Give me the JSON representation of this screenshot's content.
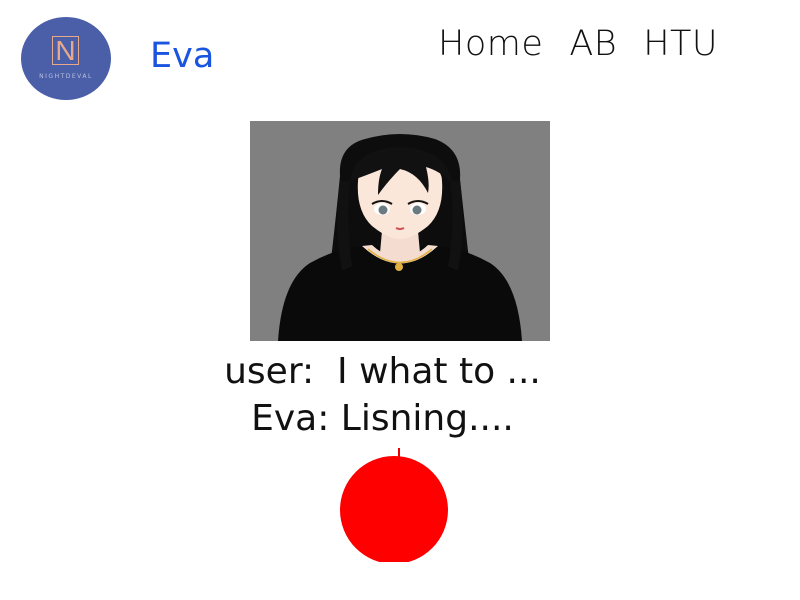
{
  "header": {
    "logo": {
      "letter": "N",
      "subtext": "NIGHTDEVAL",
      "icon": "nightdeval-logo-icon"
    },
    "brand_name": "Eva",
    "nav": [
      {
        "label": "Home"
      },
      {
        "label": "AB"
      },
      {
        "label": "HTU"
      }
    ]
  },
  "avatar": {
    "icon": "anime-avatar-image"
  },
  "transcript": {
    "user_line": "user:  I what to ...",
    "eva_line": "Eva: Lisning...."
  },
  "mic": {
    "icon": "record-button",
    "state": "listening"
  },
  "colors": {
    "brand": "#1a55e0",
    "logo_bg": "#4a5fa8",
    "logo_accent": "#e8a98a",
    "avatar_bg": "#808080",
    "mic_active": "#ff0000"
  }
}
